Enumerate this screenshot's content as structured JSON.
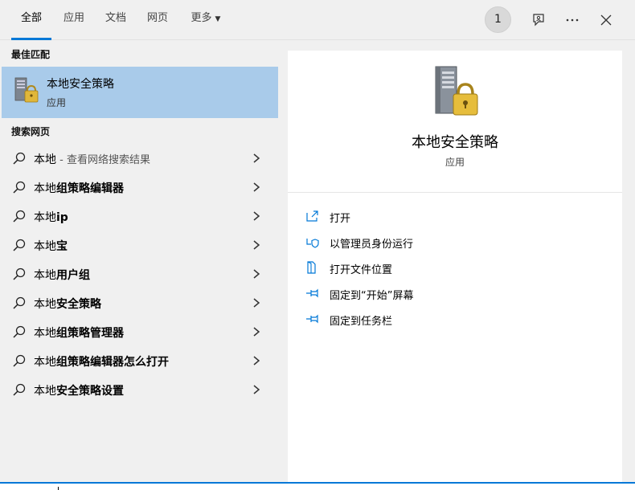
{
  "tabs": [
    {
      "label": "全部",
      "active": true
    },
    {
      "label": "应用"
    },
    {
      "label": "文档"
    },
    {
      "label": "网页"
    },
    {
      "label": "更多"
    }
  ],
  "header": {
    "badge": "1",
    "icons": [
      "feedback-icon",
      "more-icon",
      "close-icon"
    ]
  },
  "left": {
    "best_match_title": "最佳匹配",
    "best_match": {
      "title": "本地安全策略",
      "subtitle": "应用",
      "icon": "security-policy-app-icon"
    },
    "web_title": "搜索网页",
    "web_results": [
      {
        "prefix": "本地",
        "bold": "",
        "suffix": " - 查看网络搜索结果"
      },
      {
        "prefix": "本地",
        "bold": "组策略编辑器",
        "suffix": ""
      },
      {
        "prefix": "本地",
        "bold": "ip",
        "suffix": ""
      },
      {
        "prefix": "本地",
        "bold": "宝",
        "suffix": ""
      },
      {
        "prefix": "本地",
        "bold": "用户组",
        "suffix": ""
      },
      {
        "prefix": "本地",
        "bold": "安全策略",
        "suffix": ""
      },
      {
        "prefix": "本地",
        "bold": "组策略管理器",
        "suffix": ""
      },
      {
        "prefix": "本地",
        "bold": "组策略编辑器怎么打开",
        "suffix": ""
      },
      {
        "prefix": "本地",
        "bold": "安全策略设置",
        "suffix": ""
      }
    ]
  },
  "right": {
    "app_title": "本地安全策略",
    "app_subtitle": "应用",
    "actions": [
      {
        "label": "打开",
        "icon": "open-icon"
      },
      {
        "label": "以管理员身份运行",
        "icon": "shield-icon"
      },
      {
        "label": "打开文件位置",
        "icon": "file-location-icon"
      },
      {
        "label": "固定到“开始”屏幕",
        "icon": "pin-icon"
      },
      {
        "label": "固定到任务栏",
        "icon": "pin-icon"
      }
    ]
  },
  "colors": {
    "accent": "#0078d7",
    "selected": "#a9cbea",
    "pane": "#f0f0f0"
  }
}
